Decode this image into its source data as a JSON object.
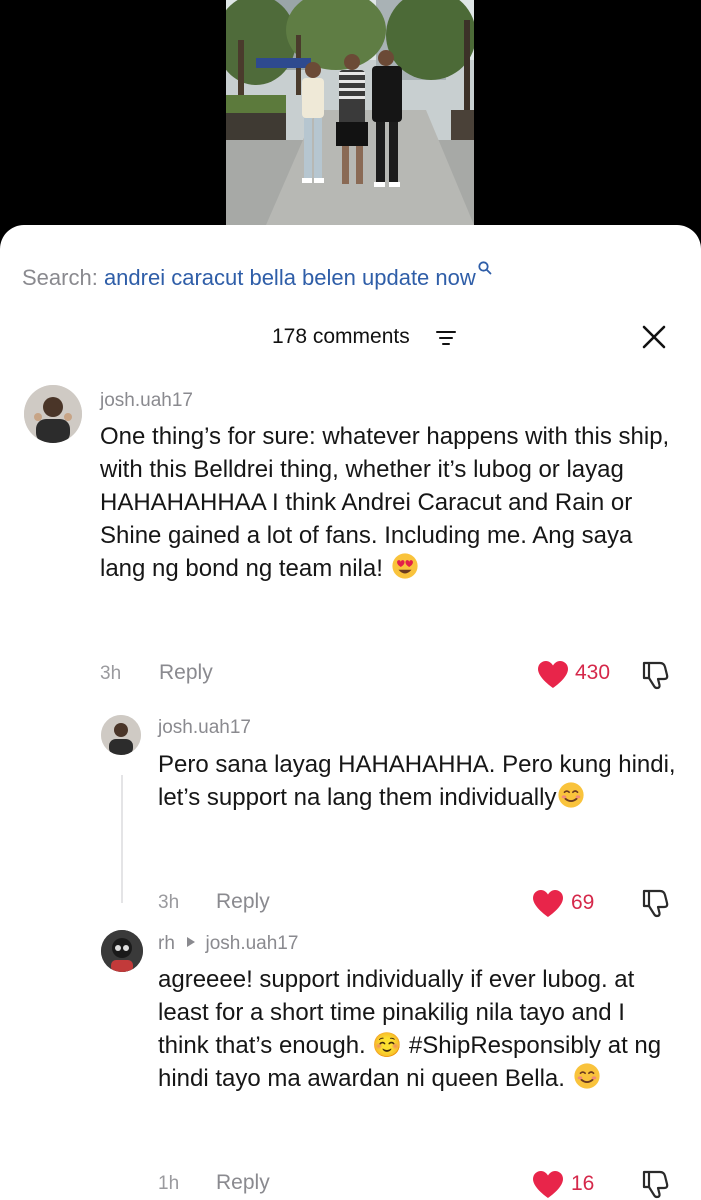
{
  "search": {
    "prefix": "Search: ",
    "query": "andrei caracut bella belen update now"
  },
  "comments_header": {
    "count_label": "178 comments"
  },
  "comments": [
    {
      "username": "josh.uah17",
      "text": "One thing’s for sure: whatever happens with this ship, with this Belldrei thing, whether it’s lubog or layag HAHAHAHHAA I think Andrei Caracut and Rain or Shine gained a lot of fans. Including me. Ang saya lang ng bond ng team nila!",
      "emoji": "😍",
      "time": "3h",
      "reply_label": "Reply",
      "likes": "430"
    },
    {
      "username": "josh.uah17",
      "text": "Pero sana layag HAHAHAHHA. Pero kung hindi, let’s support na lang them individually",
      "emoji": "☺️",
      "time": "3h",
      "reply_label": "Reply",
      "likes": "69"
    },
    {
      "username": "rh",
      "reply_to": "josh.uah17",
      "text": "agreeee! support individually if ever lubog. at least for a short time pinakilig nila tayo and I think that’s enough. ☺️ #ShipResponsibly at ng hindi tayo ma awardan ni queen Bella.",
      "emoji": "☺️",
      "time": "1h",
      "reply_label": "Reply",
      "likes": "16"
    }
  ],
  "colors": {
    "link_blue": "#2f5ea8",
    "heart_red": "#e8254a",
    "muted_gray": "#8a8a8f"
  }
}
